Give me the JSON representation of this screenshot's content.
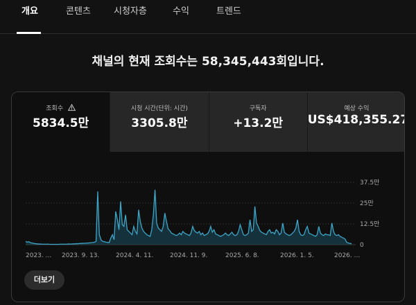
{
  "tabs": [
    {
      "label": "개요",
      "active": true
    },
    {
      "label": "콘텐츠",
      "active": false
    },
    {
      "label": "시청자층",
      "active": false
    },
    {
      "label": "수익",
      "active": false
    },
    {
      "label": "트렌드",
      "active": false
    }
  ],
  "headline": "채널의 현재 조회수는 58,345,443회입니다.",
  "metrics": [
    {
      "label": "조회수",
      "value": "5834.5만",
      "selected": true,
      "icon": "warning-icon"
    },
    {
      "label": "시청 시간(단위: 시간)",
      "value": "3305.8만",
      "selected": false
    },
    {
      "label": "구독자",
      "value": "+13.2만",
      "selected": false
    },
    {
      "label": "예상 수익",
      "value": "US$418,355.27",
      "selected": false
    }
  ],
  "more_button": "더보기",
  "colors": {
    "line": "#3ea6c8",
    "fill": "#1c4f60",
    "grid": "#3a3a3a",
    "background": "#121212"
  },
  "chart_data": {
    "type": "line",
    "ylabel": "",
    "ylim": [
      0,
      375000
    ],
    "y_ticks": [
      {
        "value": 0,
        "label": "0"
      },
      {
        "value": 125000,
        "label": "12.5만"
      },
      {
        "value": 250000,
        "label": "25만"
      },
      {
        "value": 375000,
        "label": "37.5만"
      }
    ],
    "x_tick_labels": [
      "2023. ...",
      "2023. 9. 13.",
      "2024. 4. 11.",
      "2024. 11. 9.",
      "2025. 6. 8.",
      "2026. 1. 5.",
      "2026. ..."
    ],
    "series": [
      {
        "values": [
          20000,
          15000,
          18000,
          12000,
          10000,
          8000,
          6000,
          5000,
          4000,
          4000,
          3000,
          3000,
          3000,
          3000,
          3000,
          2000,
          2000,
          2000,
          2000,
          2000,
          2000,
          3000,
          3000,
          3000,
          3000,
          3000,
          4000,
          4000,
          4000,
          5000,
          5000,
          6000,
          6000,
          7000,
          8000,
          8000,
          9000,
          10000,
          10000,
          11000,
          12000,
          13000,
          15000,
          20000,
          320000,
          60000,
          30000,
          20000,
          18000,
          15000,
          14000,
          13000,
          40000,
          60000,
          30000,
          200000,
          150000,
          90000,
          260000,
          120000,
          110000,
          180000,
          90000,
          80000,
          70000,
          60000,
          110000,
          80000,
          65000,
          210000,
          140000,
          100000,
          80000,
          70000,
          60000,
          55000,
          50000,
          90000,
          180000,
          330000,
          130000,
          100000,
          90000,
          80000,
          110000,
          190000,
          140000,
          95000,
          85000,
          70000,
          65000,
          60000,
          55000,
          60000,
          70000,
          60000,
          80000,
          70000,
          65000,
          60000,
          55000,
          70000,
          110000,
          85000,
          75000,
          70000,
          80000,
          60000,
          70000,
          55000,
          60000,
          65000,
          80000,
          110000,
          75000,
          90000,
          65000,
          60000,
          55000,
          50000,
          55000,
          60000,
          70000,
          60000,
          55000,
          65000,
          75000,
          60000,
          55000,
          60000,
          80000,
          120000,
          90000,
          60000,
          55000,
          60000,
          70000,
          150000,
          80000,
          90000,
          230000,
          130000,
          110000,
          85000,
          75000,
          70000,
          65000,
          60000,
          80000,
          90000,
          70000,
          75000,
          65000,
          90000,
          80000,
          60000,
          70000,
          130000,
          75000,
          65000,
          60000,
          55000,
          60000,
          70000,
          80000,
          100000,
          150000,
          80000,
          60000,
          55000,
          60000,
          90000,
          110000,
          70000,
          65000,
          60000,
          55000,
          50000,
          60000,
          110000,
          70000,
          60000,
          55000,
          65000,
          60000,
          60000,
          55000,
          130000,
          80000,
          60000,
          55000,
          60000,
          50000,
          45000,
          40000,
          35000,
          15000,
          10000,
          8000,
          6000
        ]
      }
    ]
  }
}
